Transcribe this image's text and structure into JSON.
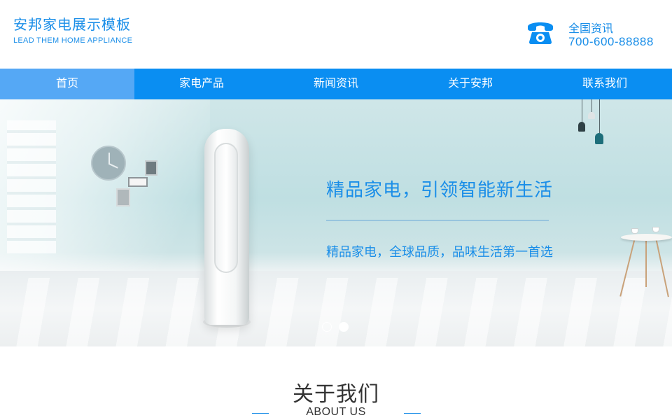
{
  "brand": {
    "title": "安邦家电展示模板",
    "subtitle": "LEAD THEM HOME APPLIANCE"
  },
  "contact": {
    "icon": "telephone-icon",
    "label": "全国资讯",
    "number": "700-600-88888"
  },
  "nav": {
    "items": [
      {
        "label": "首页",
        "active": true
      },
      {
        "label": "家电产品",
        "active": false
      },
      {
        "label": "新闻资讯",
        "active": false
      },
      {
        "label": "关于安邦",
        "active": false
      },
      {
        "label": "联系我们",
        "active": false
      }
    ]
  },
  "banner": {
    "title": "精品家电，引领智能新生活",
    "subtitle": "精品家电，全球品质，品味生活第一首选",
    "slides_total": 2,
    "active_slide": 2
  },
  "about": {
    "title": "关于我们",
    "subtitle": "ABOUT US"
  },
  "colors": {
    "accent": "#1a8ee8",
    "nav_bg": "#0a8ef2",
    "nav_active_bg": "#55a8f5",
    "heading_text": "#333333"
  }
}
